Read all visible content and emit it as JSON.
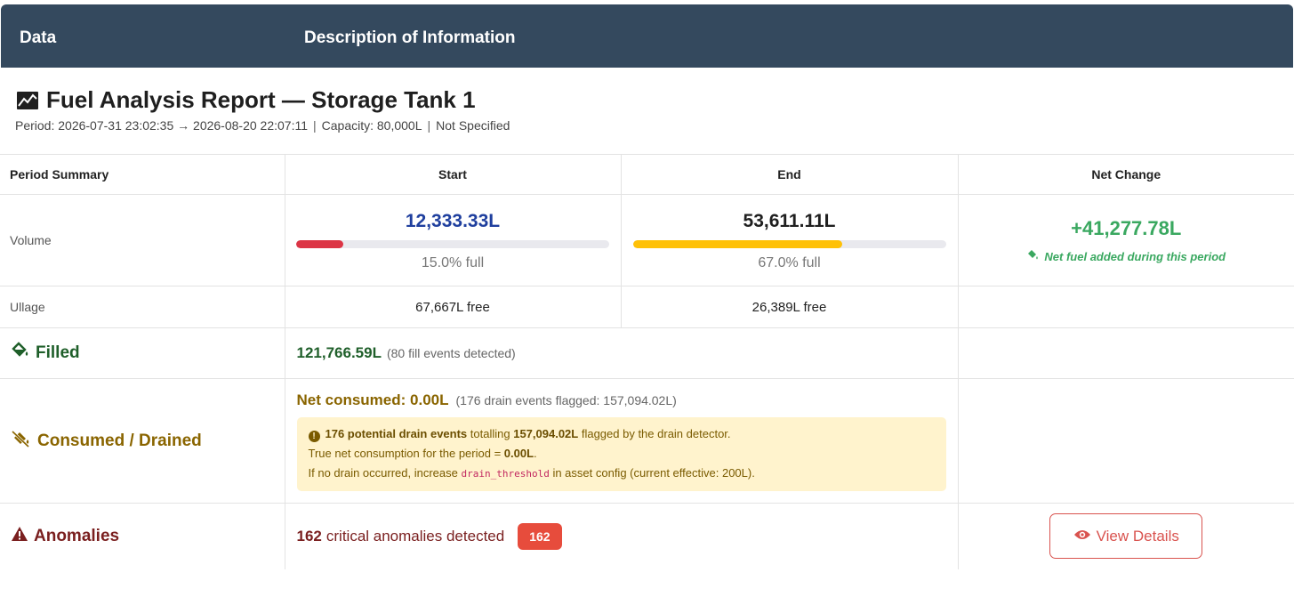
{
  "header": {
    "col1": "Data",
    "col2": "Description of Information"
  },
  "report": {
    "title": "Fuel Analysis Report — Storage Tank 1",
    "icon": "chart-line-icon",
    "period": "Period: 2026-07-31 23:02:35 → 2026-08-20 22:07:11",
    "capacity": "Capacity: 80,000L",
    "extra": "Not Specified",
    "separator": "|"
  },
  "summary": {
    "headers": [
      "Period Summary",
      "Start",
      "End",
      "Net Change"
    ],
    "volume_label": "Volume",
    "start": {
      "value": "12,333.33L",
      "pct_text": "15.0% full",
      "fill": 0.15,
      "value_color": "#1f3f9e",
      "bar_color": "#dc3545"
    },
    "end": {
      "value": "53,611.11L",
      "pct_text": "67.0% full",
      "fill": 0.67,
      "value_color": "#1f1f1f",
      "bar_color": "#ffc107"
    },
    "net": {
      "value": "+41,277.78L",
      "note": "Net fuel added during this period",
      "color": "#3aa860"
    },
    "ullage_label": "Ullage",
    "ullage_start": "67,667L free",
    "ullage_end": "26,389L free"
  },
  "filled": {
    "label": "Filled",
    "value": "121,766.59L",
    "note": "(80 fill events detected)"
  },
  "consumed": {
    "label": "Consumed / Drained",
    "net": "Net consumed: 0.00L",
    "flag_note": "(176 drain events flagged: 157,094.02L)",
    "warn_line1_bold1": "176 potential drain events",
    "warn_line1_mid": " totalling ",
    "warn_line1_bold2": "157,094.02L",
    "warn_line1_end": " flagged by the drain detector.",
    "warn_line2_start": "True net consumption for the period = ",
    "warn_line2_bold": "0.00L",
    "warn_line2_end": ".",
    "warn_line3_start": "If no drain occurred, increase ",
    "warn_line3_code": "drain_threshold",
    "warn_line3_end": " in asset config (current effective: 200L)."
  },
  "anomalies": {
    "label": "Anomalies",
    "count": "162",
    "text": "critical anomalies detected",
    "badge": "162",
    "button": "View Details"
  }
}
